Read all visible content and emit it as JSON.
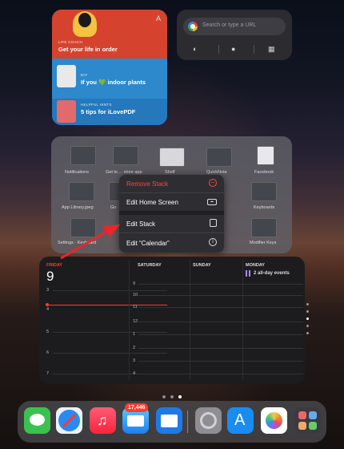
{
  "widgets": {
    "feature": {
      "items": [
        {
          "category": "LIFE COACH",
          "title": "Get your life in order"
        },
        {
          "category": "DIY",
          "title": "If you 💚 indoor plants"
        },
        {
          "category": "HELPFUL HINTS",
          "title": "5 tips for iLovePDF"
        }
      ]
    },
    "chrome": {
      "placeholder": "Search or type a URL"
    }
  },
  "stack": {
    "row1": [
      "Notifications",
      "Get to ... store app",
      "Shelf",
      "QuickNote",
      "Facebook"
    ],
    "row2": [
      "App Library.jpeg",
      "Go",
      "",
      "",
      "Keyboards"
    ],
    "row3": [
      "Settings - Keyboard",
      "",
      "",
      "",
      "Modifier Keys"
    ]
  },
  "context_menu": {
    "items": [
      {
        "label": "Remove Stack",
        "color": "#ff453a",
        "icon": "minus-circle-icon"
      },
      {
        "label": "Edit Home Screen",
        "color": "#ffffff",
        "icon": "keyboard-icon"
      },
      {
        "label": "Edit Stack",
        "color": "#ffffff",
        "icon": "stack-icon"
      },
      {
        "label": "Edit “Calendar”",
        "color": "#ffffff",
        "icon": "info-icon"
      }
    ]
  },
  "calendar": {
    "weekday": "FRIDAY",
    "date": "9",
    "hours_left": [
      "3",
      "4",
      "5",
      "6",
      "7"
    ],
    "hours_right": [
      "9",
      "10",
      "11",
      "12",
      "1",
      "2",
      "3",
      "4"
    ],
    "columns": [
      "SATURDAY",
      "SUNDAY",
      "MONDAY"
    ],
    "monday_event": "2 all-day events"
  },
  "dock": {
    "mail_badge": "17,446",
    "apps": [
      "Messages",
      "Safari",
      "Music",
      "Mail",
      "Files",
      "Settings",
      "App Store",
      "Photos",
      "App Library"
    ]
  },
  "colors": {
    "accent_red": "#ff3b30",
    "event_purple": "#a98be8"
  }
}
